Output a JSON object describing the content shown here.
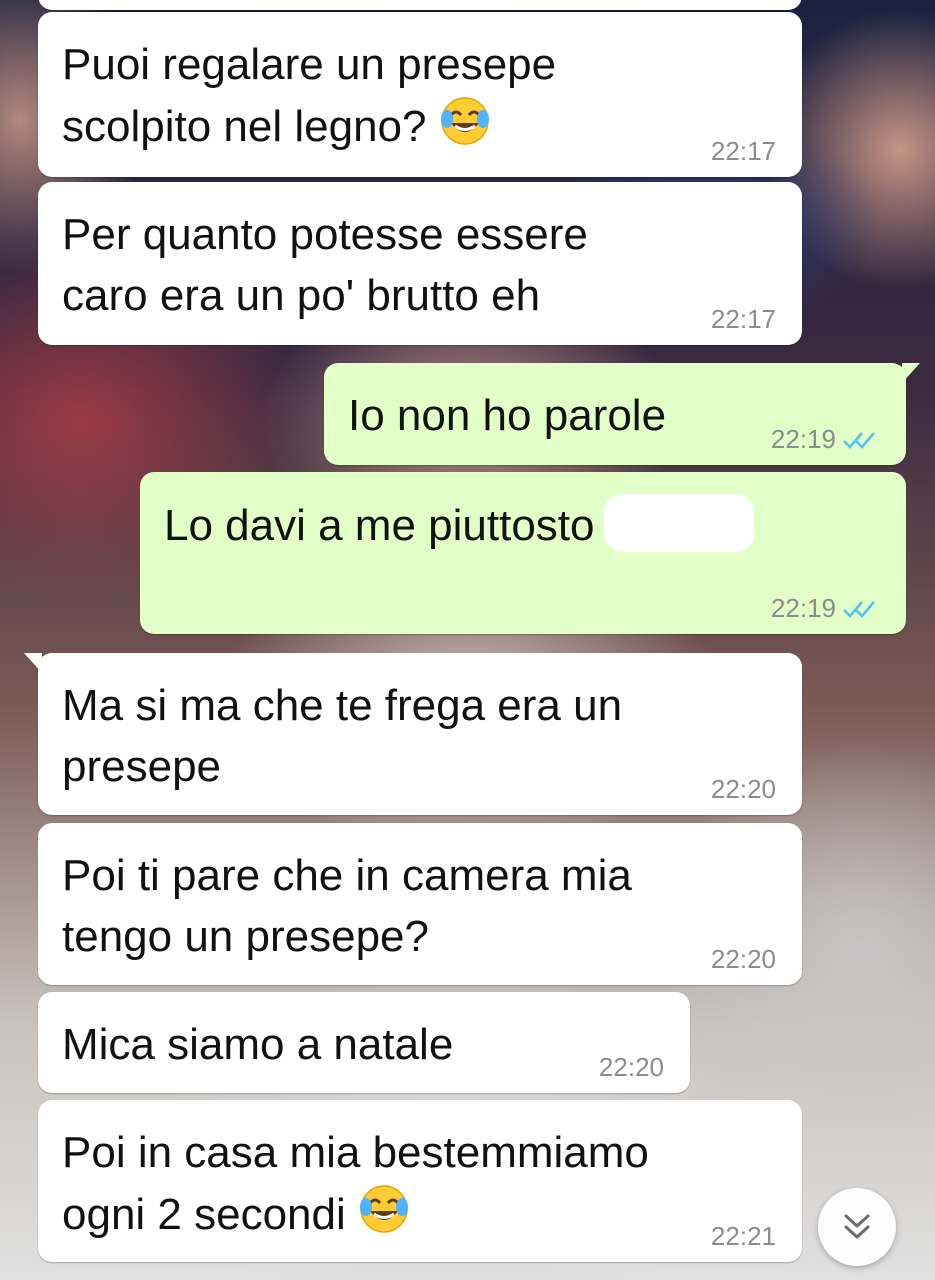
{
  "messages": [
    {
      "direction": "in",
      "text": "Puoi regalare un presepe\nscolpito nel legno?",
      "emoji": "face-with-tears-of-joy",
      "time": "22:17"
    },
    {
      "direction": "in",
      "text": "Per quanto potesse essere\ncaro era un po' brutto eh",
      "time": "22:17"
    },
    {
      "direction": "out",
      "text": "Io non ho parole",
      "time": "22:19",
      "status": "read"
    },
    {
      "direction": "out",
      "text": "Lo davi a me piuttosto",
      "redacted": true,
      "time": "22:19",
      "status": "read"
    },
    {
      "direction": "in",
      "text": "Ma si ma che te frega era un\npresepe",
      "time": "22:20"
    },
    {
      "direction": "in",
      "text": "Poi ti pare che in camera mia\ntengo un presepe?",
      "time": "22:20"
    },
    {
      "direction": "in",
      "text": "Mica siamo a natale",
      "time": "22:20"
    },
    {
      "direction": "in",
      "text": "Poi in casa mia bestemmiamo\nogni 2 secondi",
      "emoji": "face-with-tears-of-joy",
      "time": "22:21"
    }
  ],
  "colors": {
    "incoming_bubble": "#ffffff",
    "outgoing_bubble": "#e1ffc7",
    "timestamp": "#8c8c8c",
    "read_ticks": "#4fc3f7"
  },
  "scroll_button": {
    "icon": "double-chevron-down-icon"
  }
}
